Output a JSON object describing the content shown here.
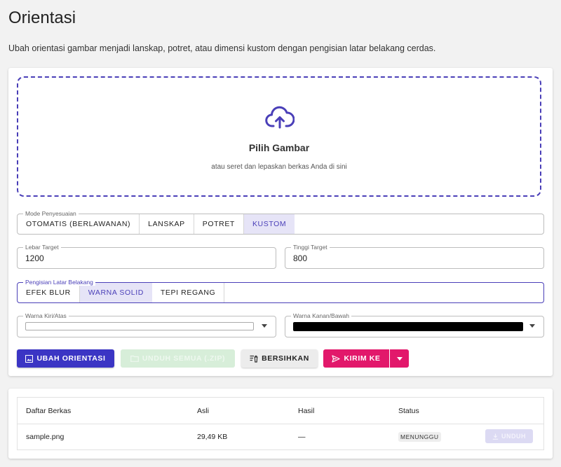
{
  "page": {
    "title": "Orientasi",
    "description": "Ubah orientasi gambar menjadi lanskap, potret, atau dimensi kustom dengan pengisian latar belakang cerdas."
  },
  "dropzone": {
    "icon": "cloud-upload-icon",
    "title": "Pilih Gambar",
    "subtitle": "atau seret dan lepaskan berkas Anda di sini"
  },
  "fit_mode": {
    "label": "Mode Penyesuaian",
    "options": [
      "OTOMATIS (BERLAWANAN)",
      "LANSKAP",
      "POTRET",
      "KUSTOM"
    ],
    "selected": "KUSTOM"
  },
  "target_width": {
    "label": "Lebar Target",
    "value": "1200"
  },
  "target_height": {
    "label": "Tinggi Target",
    "value": "800"
  },
  "background_fill": {
    "label": "Pengisian Latar Belakang",
    "options": [
      "EFEK BLUR",
      "WARNA SOLID",
      "TEPI REGANG"
    ],
    "selected": "WARNA SOLID"
  },
  "color_left": {
    "label": "Warna Kiri/Atas",
    "value": "#ffffff"
  },
  "color_right": {
    "label": "Warna Kanan/Bawah",
    "value": "#000000"
  },
  "actions": {
    "convert": "UBAH ORIENTASI",
    "download_all": "UNDUH SEMUA (.ZIP)",
    "clear": "BERSIHKAN",
    "send_to": "KIRIM KE"
  },
  "colors": {
    "primary": "#3b35c4",
    "accent": "#e2186b",
    "success_disabled": "#d7eed9"
  },
  "files": {
    "headers": [
      "Daftar Berkas",
      "Asli",
      "Hasil",
      "Status"
    ],
    "rows": [
      {
        "name": "sample.png",
        "original": "29,49 KB",
        "result": "—",
        "status": "MENUNGGU",
        "action": "UNDUH"
      }
    ]
  }
}
